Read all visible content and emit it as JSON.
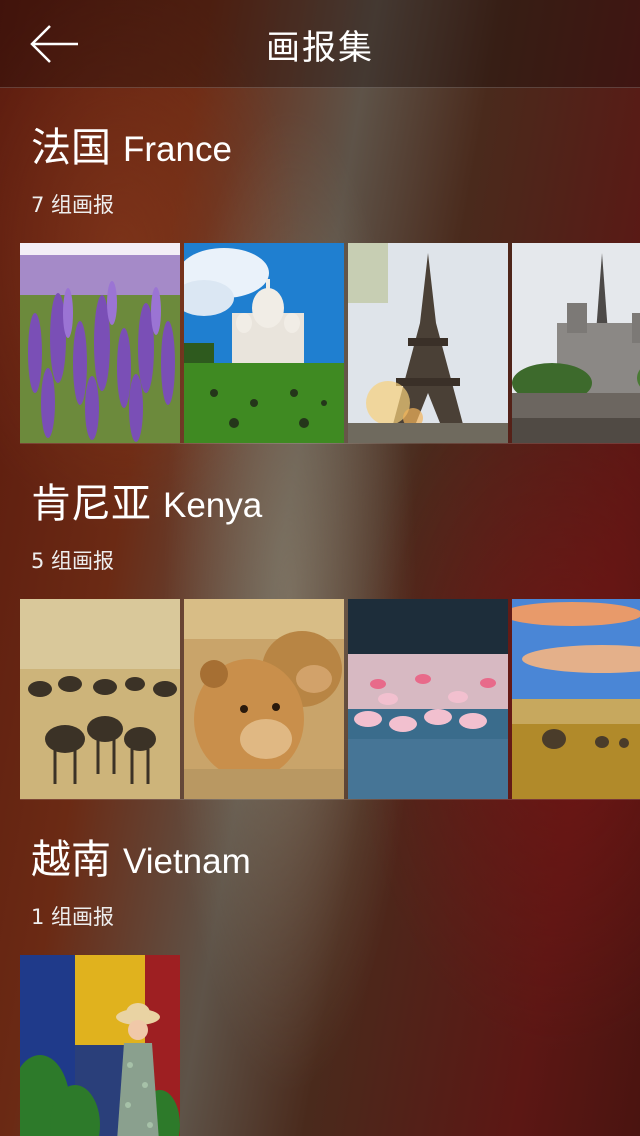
{
  "header": {
    "title": "画报集",
    "back_icon": "arrow-left-icon"
  },
  "sections": [
    {
      "cn": "法国",
      "en": "France",
      "count": "7 组画报",
      "thumbs": [
        "lavender-field",
        "sacre-coeur",
        "eiffel-tower",
        "notre-dame"
      ]
    },
    {
      "cn": "肯尼亚",
      "en": "Kenya",
      "count": "5 组画报",
      "thumbs": [
        "wildebeest-herd",
        "lionesses",
        "flamingos",
        "elephants-savanna"
      ]
    },
    {
      "cn": "越南",
      "en": "Vietnam",
      "count": "1 组画报",
      "thumbs": [
        "woman-with-hat"
      ]
    }
  ]
}
